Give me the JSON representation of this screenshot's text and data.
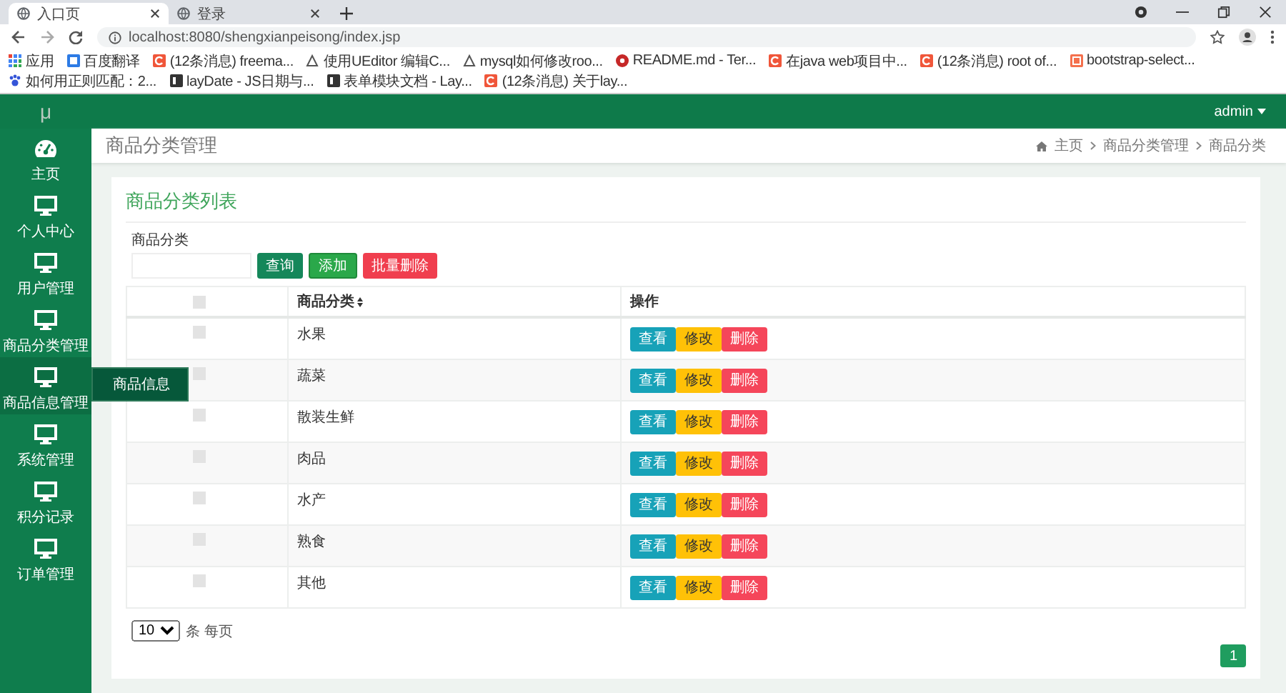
{
  "browser": {
    "tabs": [
      {
        "title": "入口页",
        "selected": true
      },
      {
        "title": "登录",
        "selected": false
      }
    ],
    "url": "localhost:8080/shengxianpeisong/index.jsp",
    "bookmarks": [
      {
        "label": "应用",
        "kind": "apps"
      },
      {
        "label": "百度翻译",
        "kind": "blue"
      },
      {
        "label": "(12条消息) freema...",
        "kind": "csdn"
      },
      {
        "label": "使用UEditor 编辑C...",
        "kind": "web"
      },
      {
        "label": "mysql如何修改roo...",
        "kind": "web"
      },
      {
        "label": "README.md - Ter...",
        "kind": "red"
      },
      {
        "label": "在java web项目中...",
        "kind": "csdn"
      },
      {
        "label": "(12条消息) root of...",
        "kind": "csdn"
      },
      {
        "label": "bootstrap-select...",
        "kind": "orange"
      },
      {
        "label": "如何用正则匹配：2...",
        "kind": "paw"
      },
      {
        "label": "layDate - JS日期与...",
        "kind": "dark"
      },
      {
        "label": "表单模块文档 - Lay...",
        "kind": "dark"
      },
      {
        "label": "(12条消息) 关于lay...",
        "kind": "csdn"
      }
    ]
  },
  "header": {
    "logo": "μ",
    "user": "admin"
  },
  "sidebar": {
    "items": [
      {
        "label": "主页",
        "kind": "dashboard",
        "expanded": false
      },
      {
        "label": "个人中心",
        "kind": "screen",
        "expanded": false
      },
      {
        "label": "用户管理",
        "kind": "screen",
        "expanded": false
      },
      {
        "label": "商品分类管理",
        "kind": "screen",
        "expanded": false
      },
      {
        "label": "商品信息管理",
        "kind": "screen",
        "expanded": true,
        "children": [
          {
            "label": "商品信息"
          }
        ]
      },
      {
        "label": "系统管理",
        "kind": "screen",
        "expanded": false
      },
      {
        "label": "积分记录",
        "kind": "screen",
        "expanded": false
      },
      {
        "label": "订单管理",
        "kind": "screen",
        "expanded": false
      }
    ]
  },
  "page": {
    "title": "商品分类管理",
    "breadcrumb": [
      "主页",
      "商品分类管理",
      "商品分类"
    ]
  },
  "card": {
    "title": "商品分类列表",
    "search_label": "商品分类",
    "buttons": [
      {
        "label": "查询",
        "kind": "search"
      },
      {
        "label": "添加",
        "kind": "add"
      },
      {
        "label": "批量删除",
        "kind": "delete"
      }
    ],
    "table": {
      "header_checked": false,
      "columns": [
        "商品分类",
        "操作"
      ],
      "rows": [
        {
          "checked": false,
          "name": "水果",
          "actions": [
            {
              "label": "查看",
              "kind": "view"
            },
            {
              "label": "修改",
              "kind": "edit"
            },
            {
              "label": "删除",
              "kind": "delete"
            }
          ]
        },
        {
          "checked": false,
          "name": "蔬菜",
          "actions": [
            {
              "label": "查看",
              "kind": "view"
            },
            {
              "label": "修改",
              "kind": "edit"
            },
            {
              "label": "删除",
              "kind": "delete"
            }
          ]
        },
        {
          "checked": false,
          "name": "散装生鲜",
          "actions": [
            {
              "label": "查看",
              "kind": "view"
            },
            {
              "label": "修改",
              "kind": "edit"
            },
            {
              "label": "删除",
              "kind": "delete"
            }
          ]
        },
        {
          "checked": false,
          "name": "肉品",
          "actions": [
            {
              "label": "查看",
              "kind": "view"
            },
            {
              "label": "修改",
              "kind": "edit"
            },
            {
              "label": "删除",
              "kind": "delete"
            }
          ]
        },
        {
          "checked": false,
          "name": "水产",
          "actions": [
            {
              "label": "查看",
              "kind": "view"
            },
            {
              "label": "修改",
              "kind": "edit"
            },
            {
              "label": "删除",
              "kind": "delete"
            }
          ]
        },
        {
          "checked": false,
          "name": "熟食",
          "actions": [
            {
              "label": "查看",
              "kind": "view"
            },
            {
              "label": "修改",
              "kind": "edit"
            },
            {
              "label": "删除",
              "kind": "delete"
            }
          ]
        },
        {
          "checked": false,
          "name": "其他",
          "actions": [
            {
              "label": "查看",
              "kind": "view"
            },
            {
              "label": "修改",
              "kind": "edit"
            },
            {
              "label": "删除",
              "kind": "delete"
            }
          ]
        }
      ]
    },
    "pager": {
      "page_size": "10",
      "page_size_suffix": "条 每页",
      "pages": [
        {
          "label": "1",
          "selected": true
        }
      ]
    }
  }
}
